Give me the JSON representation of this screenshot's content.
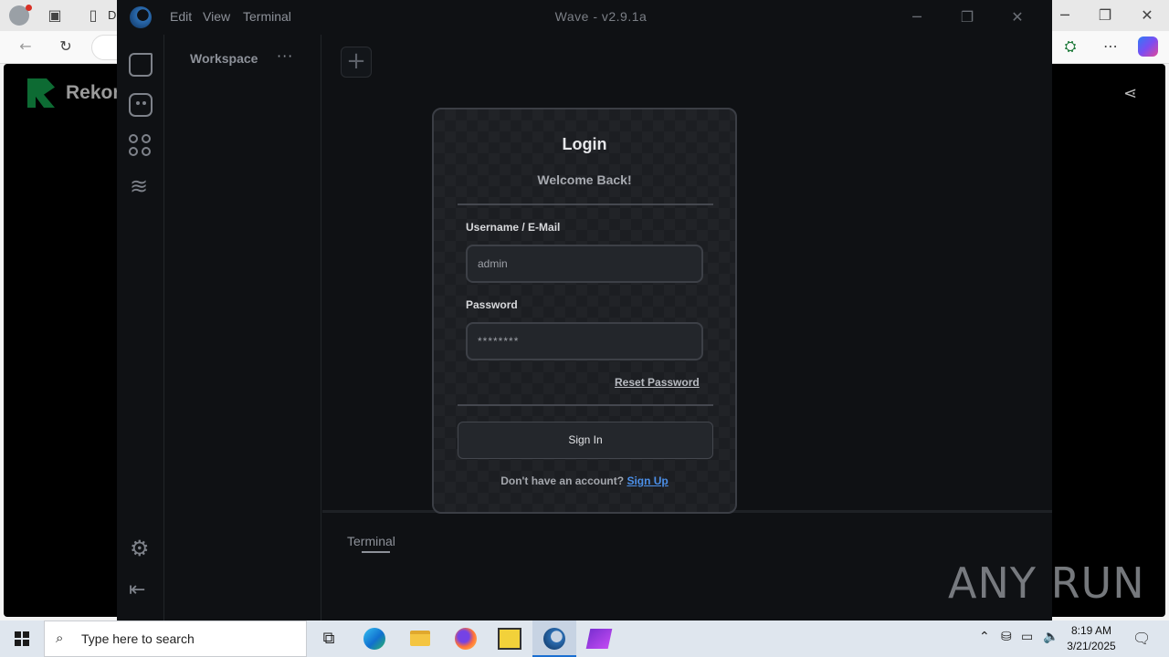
{
  "browser": {
    "tab_partial_label": "D",
    "page_brand_partial": "Rekon"
  },
  "app": {
    "title": "Wave - v2.9.1a",
    "menu": [
      "Edit",
      "View",
      "Terminal"
    ],
    "workspace_label": "Workspace",
    "workspace_more": "···",
    "add_tab_symbol": "+",
    "terminal_tab_label": "Terminal"
  },
  "login": {
    "title": "Login",
    "subtitle": "Welcome Back!",
    "username_label": "Username / E-Mail",
    "username_value": "admin",
    "password_label": "Password",
    "password_value": "********",
    "reset_password": "Reset Password",
    "sign_in": "Sign In",
    "no_account": "Don't have an account?",
    "sign_up": "Sign Up"
  },
  "watermark": "ANY RUN",
  "taskbar": {
    "search_placeholder": "Type here to search",
    "time": "8:19 AM",
    "date": "3/21/2025"
  },
  "colors": {
    "app_background": "#0f1114",
    "modal_background": "#1c1e22",
    "link_blue": "#4b8fe8",
    "taskbar": "#dfe6ee"
  }
}
